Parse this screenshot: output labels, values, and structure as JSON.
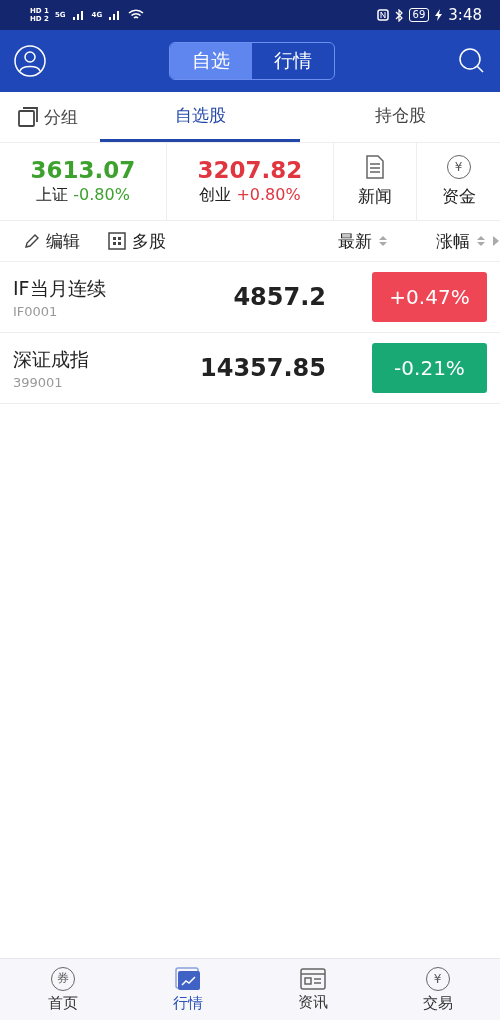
{
  "status_bar": {
    "sim": [
      "HD 1",
      "HD 2"
    ],
    "networks": [
      "5G",
      "4G"
    ],
    "battery": "69",
    "charging": true,
    "time": "3:48"
  },
  "header": {
    "segments": [
      {
        "label": "自选",
        "selected": true
      },
      {
        "label": "行情",
        "selected": false
      }
    ]
  },
  "tabs": {
    "group_label": "分组",
    "items": [
      {
        "label": "自选股",
        "selected": true
      },
      {
        "label": "持仓股",
        "selected": false
      }
    ]
  },
  "indices": [
    {
      "value": "3613.07",
      "name": "上证",
      "change": "-0.80%",
      "color": "#3da12e"
    },
    {
      "value": "3207.82",
      "name": "创业",
      "change": "+0.80%",
      "color": "#e03640"
    }
  ],
  "shortcuts": [
    {
      "label": "新闻",
      "kind": "news"
    },
    {
      "label": "资金",
      "kind": "fund",
      "glyph": "¥"
    }
  ],
  "toolbar": {
    "edit": "编辑",
    "multi": "多股",
    "latest": "最新",
    "change": "涨幅"
  },
  "rows": [
    {
      "name": "IF当月连续",
      "code": "IF0001",
      "price": "4857.2",
      "change": "+0.47%",
      "color": "#ef4655"
    },
    {
      "name": "深证成指",
      "code": "399001",
      "price": "14357.85",
      "change": "-0.21%",
      "color": "#18a974"
    }
  ],
  "nav": [
    {
      "label": "首页",
      "kind": "coupon",
      "glyph": "券",
      "selected": false
    },
    {
      "label": "行情",
      "kind": "chart",
      "selected": true
    },
    {
      "label": "资讯",
      "kind": "news",
      "selected": false
    },
    {
      "label": "交易",
      "kind": "trade",
      "glyph": "¥",
      "selected": false
    }
  ]
}
